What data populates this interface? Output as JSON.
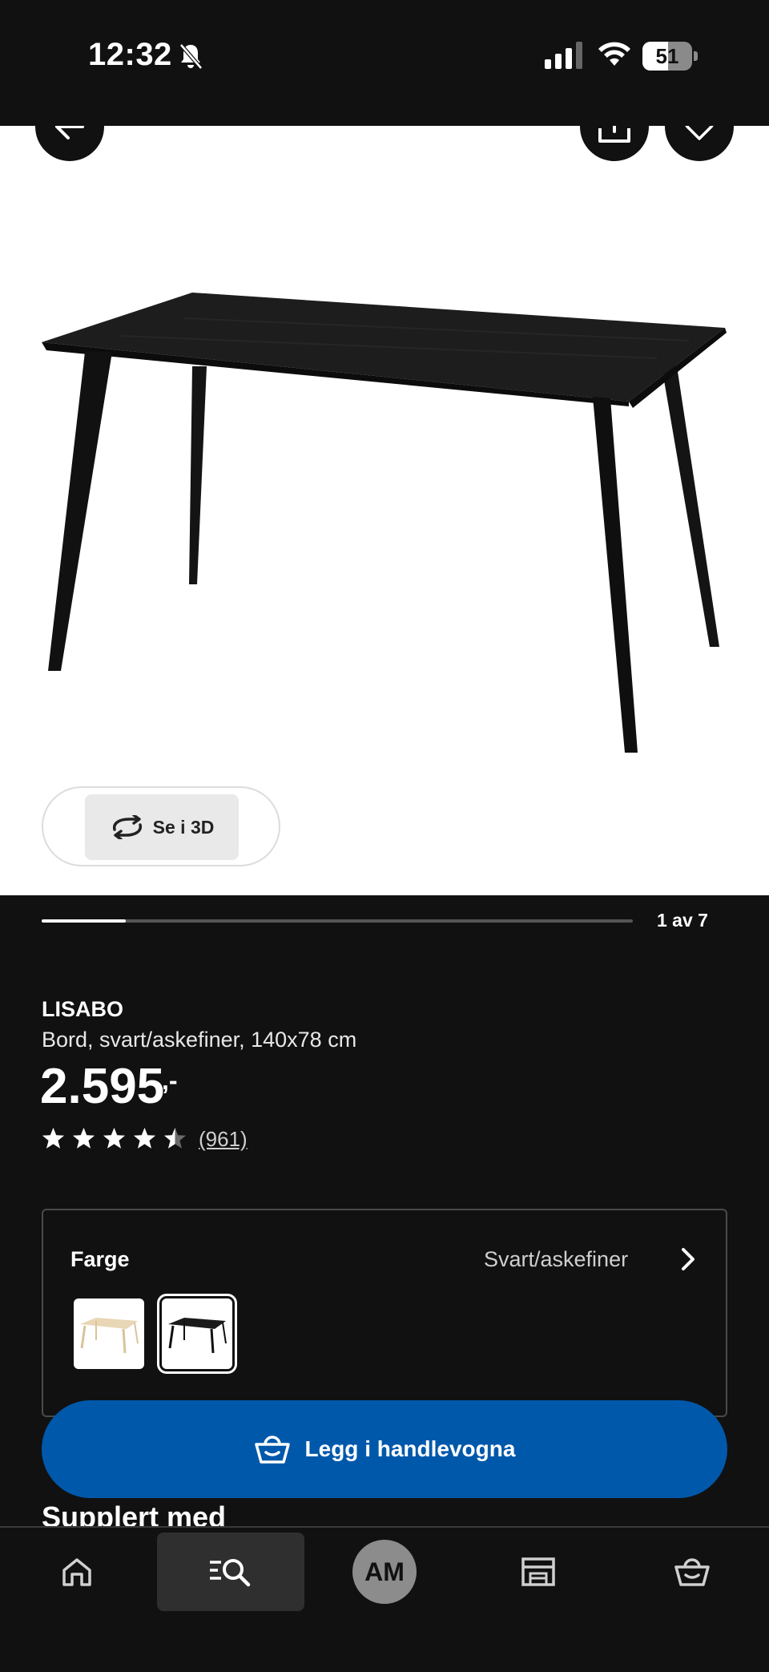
{
  "status_bar": {
    "time": "12:32",
    "battery": "51",
    "battery_level": 0.51,
    "icons": [
      "bell-muted-icon",
      "signal-icon",
      "wifi-icon",
      "battery-icon"
    ]
  },
  "hero": {
    "image": "black table product photo",
    "view_3d_label": "Se i 3D"
  },
  "gallery": {
    "counter": "1 av 7",
    "current": 1,
    "total": 7
  },
  "product": {
    "name": "LISABO",
    "description": "Bord, svart/askefiner, 140x78 cm",
    "price": "2.595",
    "price_suffix": ",-",
    "rating": 4.5,
    "review_count": "(961)"
  },
  "color_selector": {
    "label": "Farge",
    "value": "Svart/askefiner",
    "options": [
      "light-ash-table-swatch",
      "black-table-swatch"
    ],
    "selected_index": 1
  },
  "cta": {
    "add_to_cart": "Legg i handlevogna"
  },
  "section": {
    "heading": "Supplert med"
  },
  "tabbar": {
    "avatar_initials": "AM",
    "items": [
      "home-icon",
      "search-icon",
      "avatar",
      "store-icon",
      "cart-icon"
    ],
    "active": "search-icon"
  },
  "colors": {
    "background": "#111111",
    "accent_blue": "#0058ab",
    "hero_bg": "#ffffff"
  }
}
